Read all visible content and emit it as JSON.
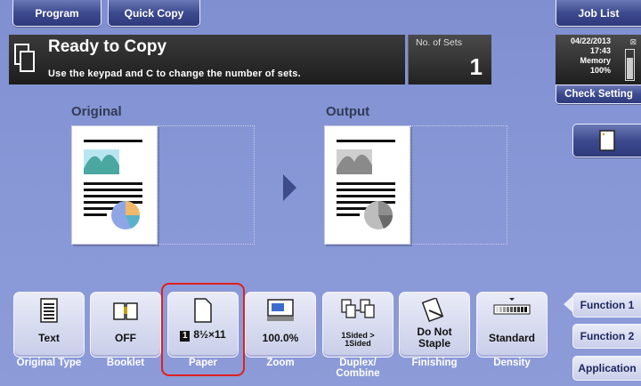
{
  "tabs": {
    "program": "Program",
    "quick_copy": "Quick Copy",
    "job_list": "Job List"
  },
  "status": {
    "title": "Ready to Copy",
    "subtitle": "Use the keypad and C to change the number of sets.",
    "sets_label": "No. of Sets",
    "sets_value": "1"
  },
  "info": {
    "date": "04/22/2013",
    "time": "17:43",
    "memory_label": "Memory",
    "memory_value": "100%",
    "memory_level": 0.75
  },
  "check_setting": "Check Setting",
  "preview": {
    "original_label": "Original",
    "output_label": "Output"
  },
  "functions": [
    {
      "value": "Text",
      "label": "Original Type",
      "icon": "document-icon"
    },
    {
      "value": "OFF",
      "label": "Booklet",
      "icon": "book-icon"
    },
    {
      "value": "8½×11",
      "badge": "1",
      "label": "Paper",
      "icon": "paper-icon"
    },
    {
      "value": "100.0%",
      "label": "Zoom",
      "icon": "zoom-icon"
    },
    {
      "value": "1Sided > 1Sided",
      "label": "Duplex/ Combine",
      "icon": "duplex-icon"
    },
    {
      "value": "Do Not Staple",
      "label": "Finishing",
      "icon": "staple-icon"
    },
    {
      "value": "Standard",
      "label": "Density",
      "icon": "density-icon"
    }
  ],
  "right_menu": {
    "function1": "Function 1",
    "function2": "Function 2",
    "application": "Application"
  },
  "colors": {
    "accent": "#3d4a8e",
    "highlight": "#e02020"
  }
}
